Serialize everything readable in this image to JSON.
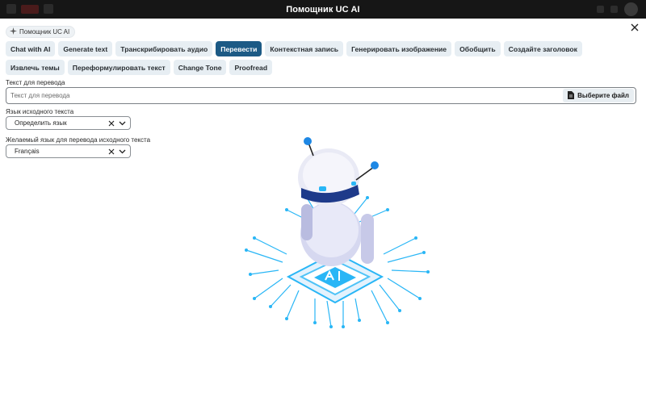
{
  "window": {
    "title": "Помощник UC AI"
  },
  "chip": {
    "label": "Помощник UC AI"
  },
  "tabs": [
    {
      "label": "Chat with AI",
      "active": false
    },
    {
      "label": "Generate text",
      "active": false
    },
    {
      "label": "Транскрибировать аудио",
      "active": false
    },
    {
      "label": "Перевести",
      "active": true
    },
    {
      "label": "Контекстная запись",
      "active": false
    },
    {
      "label": "Генерировать изображение",
      "active": false
    },
    {
      "label": "Обобщить",
      "active": false
    },
    {
      "label": "Создайте заголовок",
      "active": false
    },
    {
      "label": "Извлечь темы",
      "active": false
    },
    {
      "label": "Переформулировать текст",
      "active": false
    },
    {
      "label": "Change Tone",
      "active": false
    },
    {
      "label": "Proofread",
      "active": false
    }
  ],
  "form": {
    "text_label": "Текст для перевода",
    "text_placeholder": "Текст для перевода",
    "file_button": "Выберите файл",
    "source_label": "Язык исходного текста",
    "source_value": "Определить язык",
    "target_label": "Желаемый язык для перевода исходного текста",
    "target_value": "Français"
  },
  "colors": {
    "accent": "#1c5a85",
    "tab_bg": "#e7eef3",
    "robot_blue": "#1e88e5",
    "circuit": "#29b6f6"
  }
}
